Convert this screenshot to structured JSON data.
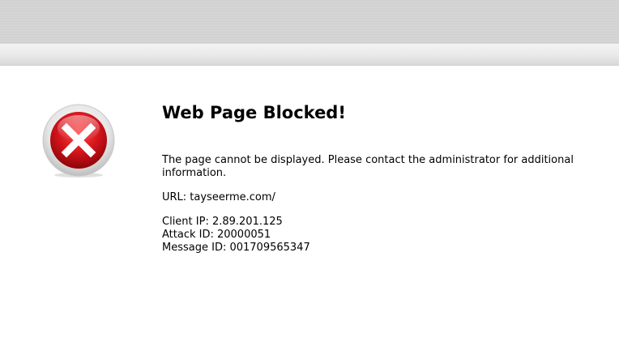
{
  "page": {
    "title": "Web Page Blocked!",
    "message": "The page cannot be displayed. Please contact the administrator for additional information.",
    "url_line": "URL: tayseerme.com/",
    "client_ip_line": "Client IP: 2.89.201.125",
    "attack_id_line": "Attack ID: 20000051",
    "message_id_line": "Message ID: 001709565347"
  },
  "icon": {
    "name": "blocked-x-icon",
    "color": "#d4151c"
  }
}
